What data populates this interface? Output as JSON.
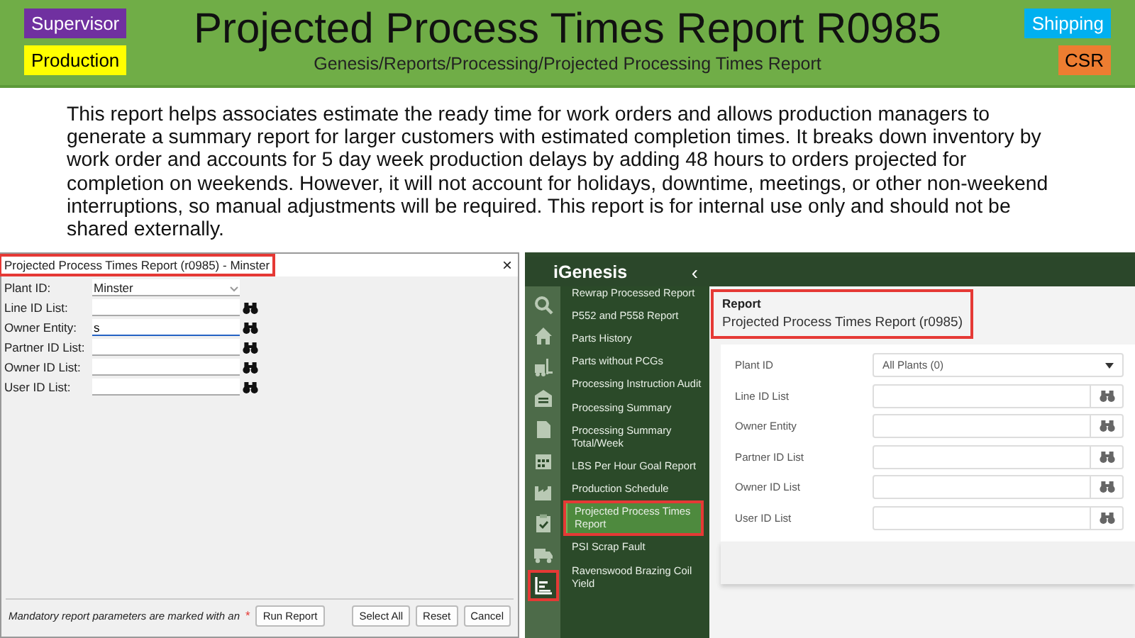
{
  "header": {
    "title": "Projected Process Times Report R0985",
    "path": "Genesis/Reports/Processing/Projected Processing Times Report",
    "left_tags": [
      {
        "label": "Supervisor",
        "color": "#7030a0"
      },
      {
        "label": "Production",
        "color": "#ffff00"
      }
    ],
    "right_tags": [
      {
        "label": "Shipping",
        "color": "#00b0f0"
      },
      {
        "label": "CSR",
        "color": "#ed7d31"
      }
    ]
  },
  "description": "This report helps associates estimate the ready time for work orders and allows production managers to generate a summary report for larger customers with estimated completion times. It breaks down inventory by work order and accounts for 5 day week production delays by adding 48 hours to orders projected for completion on weekends. However, it will not account for holidays, downtime, meetings, or other non-weekend interruptions, so manual adjustments will be required. This report is for internal use only and should not be shared externally.",
  "desktop_dialog": {
    "title": "Projected Process Times Report (r0985) - Minster",
    "title_highlighted": true,
    "close": "×",
    "fields": [
      {
        "label": "Plant ID:",
        "kind": "dropdown",
        "value": "Minster",
        "focused": false
      },
      {
        "label": "Line ID List:",
        "kind": "lookup",
        "focused": false
      },
      {
        "label": "Owner Entity:",
        "kind": "lookup",
        "value": "s",
        "focused": true
      },
      {
        "label": "Partner ID List:",
        "kind": "lookup",
        "focused": false
      },
      {
        "label": "Owner ID List:",
        "kind": "lookup",
        "focused": false
      },
      {
        "label": "User ID List:",
        "kind": "lookup",
        "focused": false
      }
    ],
    "footer_note": "Mandatory report parameters are marked with an",
    "required_mark": "*",
    "buttons": [
      "Run Report",
      "Select All",
      "Reset",
      "Cancel"
    ]
  },
  "web_app": {
    "logo": "iGenesis",
    "collapse": "‹",
    "nav_icons": [
      {
        "kind": "search",
        "selected": false
      },
      {
        "kind": "home",
        "selected": false
      },
      {
        "kind": "forklift",
        "selected": false
      },
      {
        "kind": "warehouse",
        "selected": false
      },
      {
        "kind": "document",
        "selected": false
      },
      {
        "kind": "calendar",
        "selected": false
      },
      {
        "kind": "factory",
        "selected": false
      },
      {
        "kind": "clipboard",
        "selected": false
      },
      {
        "kind": "truck",
        "selected": false
      },
      {
        "kind": "chart",
        "selected": true
      }
    ],
    "menu": [
      {
        "label": "Rewrap Processed Report",
        "selected": false
      },
      {
        "label": "P552 and P558 Report",
        "selected": false
      },
      {
        "label": "Parts History",
        "selected": false
      },
      {
        "label": "Parts without PCGs",
        "selected": false
      },
      {
        "label": "Processing Instruction Audit",
        "selected": false
      },
      {
        "label": "Processing Summary",
        "selected": false
      },
      {
        "label": "Processing Summary Total/Week",
        "selected": false
      },
      {
        "label": "LBS Per Hour Goal Report",
        "selected": false
      },
      {
        "label": "Production Schedule",
        "selected": false
      },
      {
        "label": "Projected Process Times Report",
        "selected": true
      },
      {
        "label": "PSI Scrap Fault",
        "selected": false
      },
      {
        "label": "Ravenswood Brazing Coil Yield",
        "selected": false
      }
    ],
    "report": {
      "heading": "Report",
      "name": "Projected Process Times Report (r0985)",
      "highlighted": true,
      "fields": [
        {
          "label": "Plant ID",
          "kind": "dropdown",
          "value": "All Plants (0)"
        },
        {
          "label": "Line ID List",
          "kind": "lookup"
        },
        {
          "label": "Owner Entity",
          "kind": "lookup"
        },
        {
          "label": "Partner ID List",
          "kind": "lookup"
        },
        {
          "label": "Owner ID List",
          "kind": "lookup"
        },
        {
          "label": "User ID List",
          "kind": "lookup"
        }
      ]
    }
  }
}
